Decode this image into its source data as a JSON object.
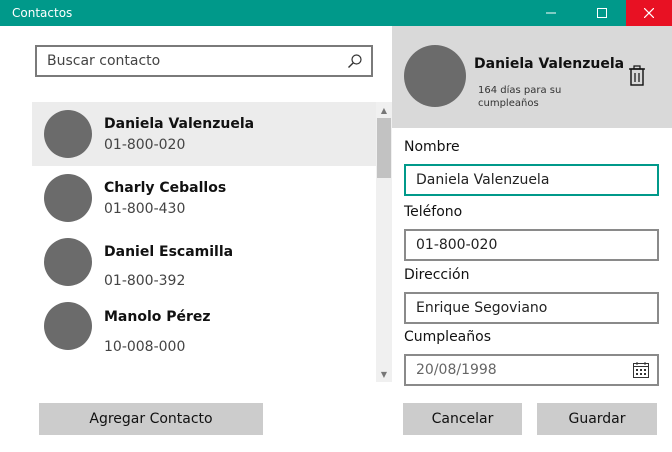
{
  "window": {
    "title": "Contactos"
  },
  "search": {
    "placeholder": "Buscar contacto",
    "value": ""
  },
  "contacts": [
    {
      "name": "Daniela Valenzuela",
      "phone": "01-800-020"
    },
    {
      "name": "Charly Ceballos",
      "phone": "01-800-430"
    },
    {
      "name": "Daniel Escamilla",
      "phone": "01-800-392"
    },
    {
      "name": "Manolo Pérez",
      "phone": "10-008-000"
    }
  ],
  "list_actions": {
    "add_label": "Agregar Contacto"
  },
  "detail": {
    "name": "Daniela Valenzuela",
    "birthday_note": "164 días para su cumpleaños",
    "fields": {
      "name_label": "Nombre",
      "name_value": "Daniela Valenzuela",
      "phone_label": "Teléfono",
      "phone_value": "01-800-020",
      "address_label": "Dirección",
      "address_value": "Enrique Segoviano",
      "birthday_label": "Cumpleaños",
      "birthday_value": "20/08/1998"
    },
    "cancel_label": "Cancelar",
    "save_label": "Guardar"
  },
  "colors": {
    "accent": "#00998a",
    "close": "#e81123",
    "avatar": "#6b6b6b"
  },
  "icons": {
    "search": "search-icon",
    "trash": "trash-icon",
    "calendar": "calendar-icon"
  }
}
